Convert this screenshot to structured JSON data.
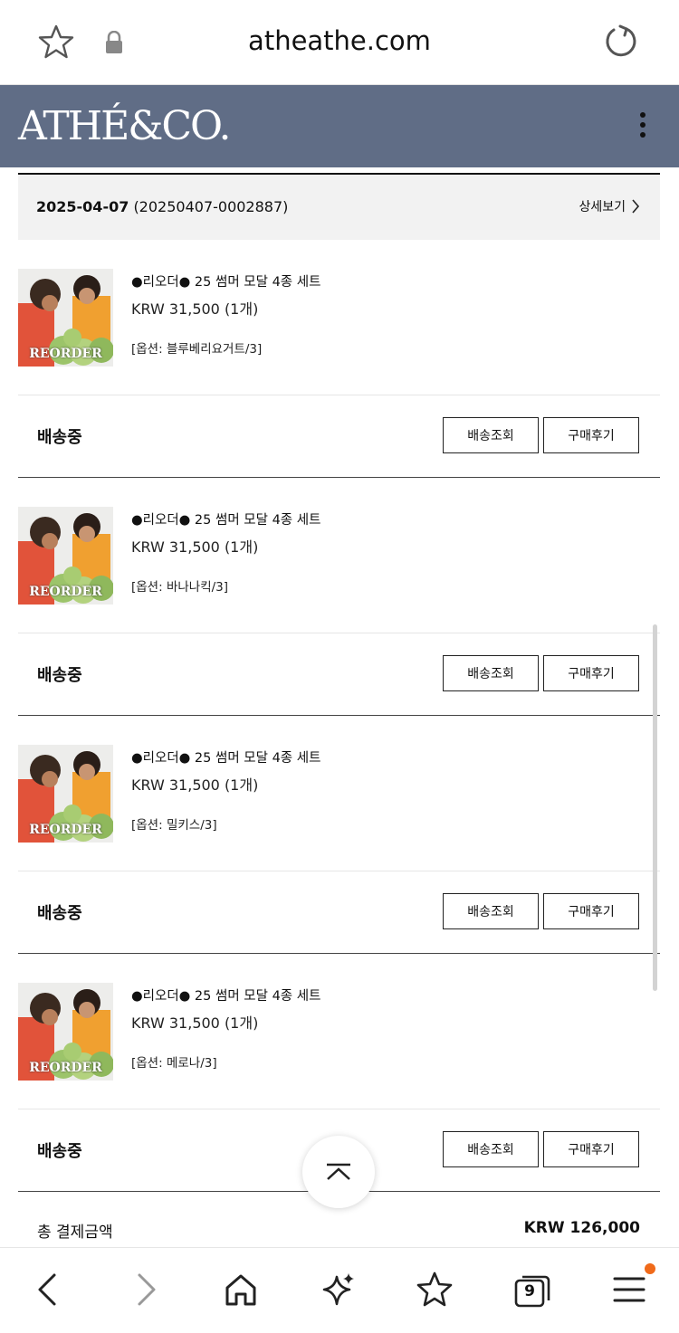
{
  "browser": {
    "url": "atheathe.com",
    "bottom_nav": {
      "back": "back-arrow-icon",
      "forward": "forward-arrow-icon",
      "home": "home-icon",
      "ai": "sparkle-icon",
      "bookmarks": "bookmark-star-icon",
      "tabs_count": "9",
      "menu": "menu-icon"
    }
  },
  "site": {
    "logo": "ATHÉ&CO.",
    "header_color": "#606d86"
  },
  "order": {
    "date": "2025-04-07",
    "number": "(20250407-0002887)",
    "detail_label": "상세보기",
    "items": [
      {
        "name": "●리오더● 25 썸머 모달 4종 세트",
        "price": "KRW 31,500 (1개)",
        "option": "[옵션: 블루베리요거트/3]",
        "status": "배송중",
        "track_label": "배송조회",
        "review_label": "구매후기",
        "thumb_label": "REORDER"
      },
      {
        "name": "●리오더● 25 썸머 모달 4종 세트",
        "price": "KRW 31,500 (1개)",
        "option": "[옵션: 바나나킥/3]",
        "status": "배송중",
        "track_label": "배송조회",
        "review_label": "구매후기",
        "thumb_label": "REORDER"
      },
      {
        "name": "●리오더● 25 썸머 모달 4종 세트",
        "price": "KRW 31,500 (1개)",
        "option": "[옵션: 밀키스/3]",
        "status": "배송중",
        "track_label": "배송조회",
        "review_label": "구매후기",
        "thumb_label": "REORDER"
      },
      {
        "name": "●리오더● 25 썸머 모달 4종 세트",
        "price": "KRW 31,500 (1개)",
        "option": "[옵션: 메로나/3]",
        "status": "배송중",
        "track_label": "배송조회",
        "review_label": "구매후기",
        "thumb_label": "REORDER"
      }
    ],
    "total_label": "총 결제금액",
    "total_value": "KRW 126,000"
  }
}
